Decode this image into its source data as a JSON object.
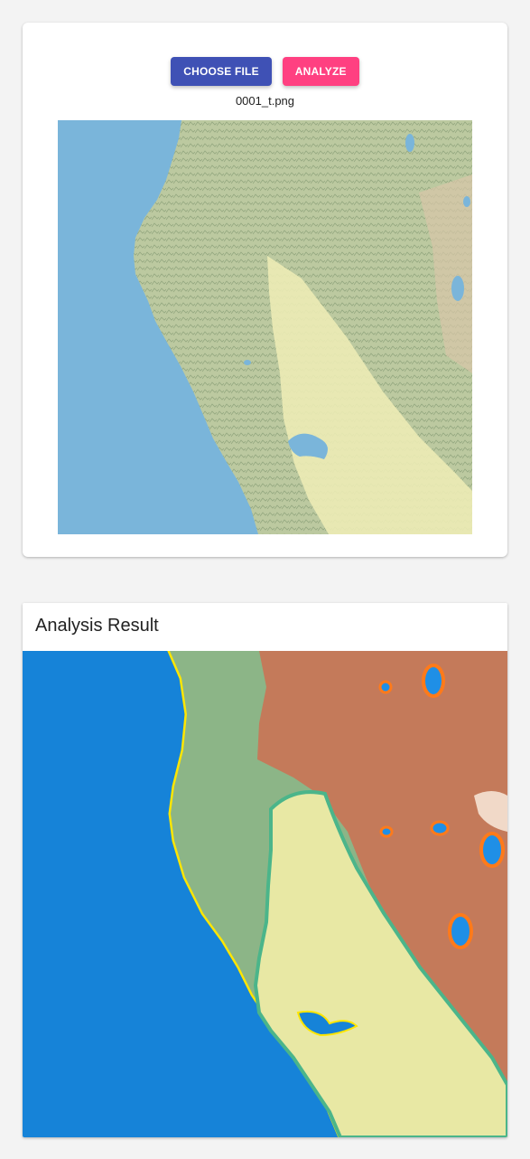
{
  "upload": {
    "choose_label": "CHOOSE FILE",
    "analyze_label": "ANALYZE",
    "filename": "0001_t.png"
  },
  "result": {
    "title": "Analysis Result"
  },
  "colors": {
    "choose_button": "#3f51b5",
    "analyze_button": "#ff4081",
    "ocean": "#7ab5da",
    "land": "#c5d1a6",
    "valley": "#ecebb5",
    "seg_water": "#1683d8",
    "seg_forest": "#8cb587",
    "seg_urban": "#c47a5a",
    "seg_valley": "#e8e8a4"
  }
}
